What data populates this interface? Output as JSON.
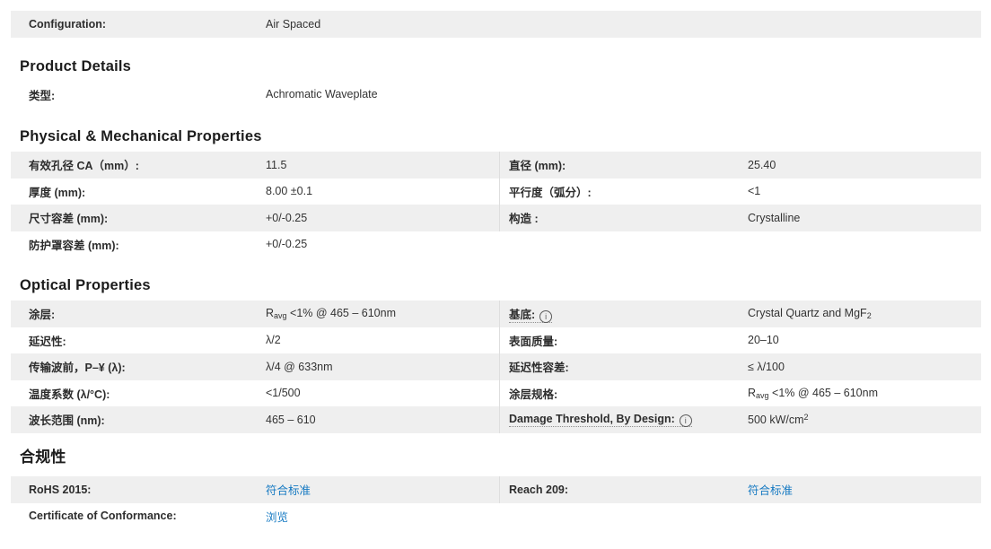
{
  "colors": {
    "stripe": "#efefef",
    "divider": "#dedede",
    "link": "#1579c2",
    "text": "#333333"
  },
  "icons": {
    "info_glyph": "i"
  },
  "config_row": {
    "label": "Configuration:",
    "value": "Air Spaced"
  },
  "product_details": {
    "heading": "Product Details",
    "row": {
      "label": "类型:",
      "value": "Achromatic Waveplate"
    }
  },
  "physical": {
    "heading": "Physical & Mechanical Properties",
    "left": [
      {
        "label": "有效孔径 CA（mm）:",
        "value": "11.5"
      },
      {
        "label": "厚度 (mm):",
        "value": "8.00 ±0.1"
      },
      {
        "label": "尺寸容差 (mm):",
        "value": "+0/-0.25"
      },
      {
        "label": "防护罩容差 (mm):",
        "value": "+0/-0.25"
      }
    ],
    "right": [
      {
        "label": "直径 (mm):",
        "value": "25.40"
      },
      {
        "label": "平行度（弧分）:",
        "value": "<1"
      },
      {
        "label": "构造 :",
        "value": "Crystalline"
      }
    ]
  },
  "optical": {
    "heading": "Optical Properties",
    "left": [
      {
        "label": "涂层:",
        "v_pre": "R",
        "v_sub": "avg",
        "v_post": " <1% @ 465 – 610nm"
      },
      {
        "label": "延迟性:",
        "value": "λ/2"
      },
      {
        "label": "传输波前，P–¥ (λ):",
        "value": "λ/4 @ 633nm"
      },
      {
        "label": "温度系数 (λ/°C):",
        "value": "<1/500"
      },
      {
        "label": "波长范围 (nm):",
        "value": "465 – 610"
      }
    ],
    "right": [
      {
        "label": "基底:",
        "v_pre": "Crystal Quartz and MgF",
        "v_sub": "2"
      },
      {
        "label": "表面质量:",
        "value": "20–10"
      },
      {
        "label": "延迟性容差:",
        "value": "≤ λ/100"
      },
      {
        "label": "涂层规格:",
        "v_pre": "R",
        "v_sub": "avg",
        "v_post": " <1% @ 465 – 610nm"
      },
      {
        "label": "Damage Threshold, By Design:",
        "v_pre": "500 kW/cm",
        "v_sup": "2"
      }
    ]
  },
  "compliance": {
    "heading": "合规性",
    "left": [
      {
        "label": "RoHS 2015:",
        "link": "符合标准"
      },
      {
        "label": "Certificate of Conformance:",
        "link": "浏览"
      }
    ],
    "right": [
      {
        "label": "Reach 209:",
        "link": "符合标准"
      }
    ]
  }
}
